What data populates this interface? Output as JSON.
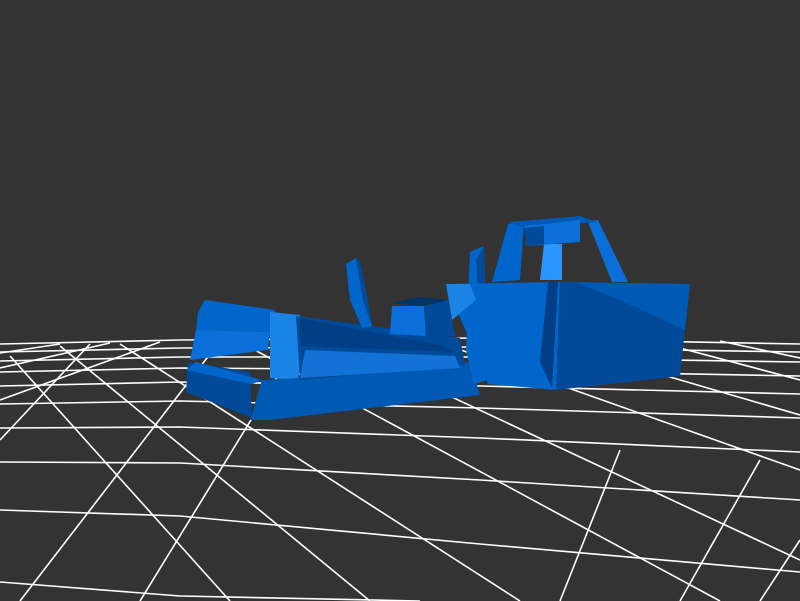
{
  "scene": {
    "background_color": "#333333",
    "grid_color": "#ffffff",
    "model_colors": {
      "base": "#0066cc",
      "light": "#1a85e6",
      "highlight": "#2b95ff",
      "shadow": "#004a99",
      "dark": "#003366"
    },
    "model_icon": "tractor-model-icon"
  }
}
